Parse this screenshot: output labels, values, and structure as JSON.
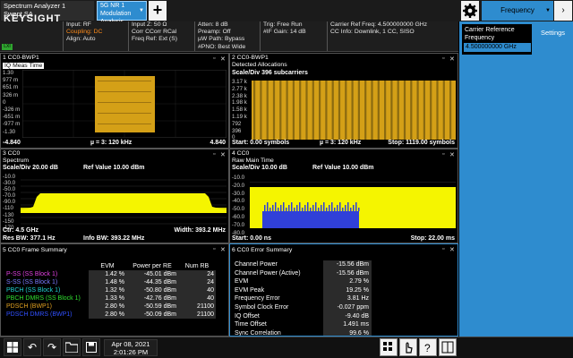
{
  "tabs": {
    "app_line1": "Spectrum Analyzer 1",
    "app_line2": "Swept SA",
    "mode_line1": "5G NR 1",
    "mode_line2": "Modulation Analysis",
    "add_label": "+"
  },
  "status": {
    "logo": "KEYSIGHT",
    "lxi": "LXI",
    "group1": [
      "Input: RF",
      "Coupling: DC",
      "Align: Auto"
    ],
    "group2": [
      "Input Z: 50 Ω",
      "Corr CCorr RCal",
      "Freq Ref: Ext (S)"
    ],
    "group3": [
      "Atten: 8 dB",
      "Preamp: Off",
      "µW Path: Bypass",
      "#PNO: Best Wide"
    ],
    "group4": [
      "Trig: Free Run",
      "#IF Gain: 14 dB"
    ],
    "group5": [
      "Carrier Ref Freq: 4.500000000 GHz",
      "CC Info: Downlink, 1 CC, SISO"
    ]
  },
  "menu": {
    "title": "Frequency",
    "carrier_label": "Carrier Reference Frequency",
    "carrier_value": "4.500000000 GHz",
    "settings": "Settings"
  },
  "win1": {
    "title1": "1 CC0-BWP1",
    "title2": "IQ Meas Time",
    "ylabels": [
      "1.30",
      "977 m",
      "651 m",
      "326 m",
      "0",
      "-326 m",
      "-651 m",
      "-977 m",
      "-1.30"
    ],
    "foot_left": "-4.840",
    "foot_mid": "µ = 3: 120 kHz",
    "foot_right": "4.840"
  },
  "win2": {
    "title1": "2 CC0-BWP1",
    "title2": "Detected Allocations",
    "header": "Scale/Div 396 subcarriers",
    "ylabels": [
      "3.17 k",
      "2.77 k",
      "2.38 k",
      "1.98 k",
      "1.58 k",
      "1.19 k",
      "792",
      "396",
      "0"
    ],
    "foot_left": "Start: 0.00 symbols",
    "foot_mid": "µ = 3: 120 kHz",
    "foot_right": "Stop: 1119.00 symbols"
  },
  "win3": {
    "title1": "3 CC0",
    "title2": "Spectrum",
    "header_left": "Scale/Div 20.00 dB",
    "header_right": "Ref Value 10.00 dBm",
    "ylabels": [
      "-10.0",
      "-30.0",
      "-50.0",
      "-70.0",
      "-90.0",
      "-110",
      "-130",
      "-150",
      "-170"
    ],
    "foot1_left": "Ctr: 4.5 GHz",
    "foot1_right": "Width: 393.2 MHz",
    "foot2_left": "Res BW: 377.1 Hz",
    "foot2_mid": "Info BW: 393.22 MHz"
  },
  "win4": {
    "title1": "4 CC0",
    "title2": "Raw Main Time",
    "header_left": "Scale/Div 10.00 dB",
    "header_right": "Ref Value 10.00 dBm",
    "ylabels": [
      "-10.0",
      "-20.0",
      "-30.0",
      "-40.0",
      "-50.0",
      "-60.0",
      "-70.0",
      "-80.0"
    ],
    "foot_left": "Start: 0.00 ns",
    "foot_right": "Stop: 22.00 ms"
  },
  "win5": {
    "title": "5 CC0 Frame Summary",
    "columns": [
      "",
      "EVM",
      "Power per RE",
      "Num RB"
    ],
    "rows": [
      {
        "name": "P-SS (SS Block 1)",
        "color": "#e040e0",
        "evm": "1.42 %",
        "power": "-45.01 dBm",
        "rb": "24"
      },
      {
        "name": "S-SS (SS Block 1)",
        "color": "#7a7aff",
        "evm": "1.48 %",
        "power": "-44.35 dBm",
        "rb": "24"
      },
      {
        "name": "PBCH (SS Block 1)",
        "color": "#20d0d0",
        "evm": "1.32 %",
        "power": "-50.80 dBm",
        "rb": "40"
      },
      {
        "name": "PBCH DMRS (SS Block 1)",
        "color": "#30e030",
        "evm": "1.33 %",
        "power": "-42.76 dBm",
        "rb": "40"
      },
      {
        "name": "PDSCH (BWP1)",
        "color": "#e0a020",
        "evm": "2.80 %",
        "power": "-50.59 dBm",
        "rb": "21100"
      },
      {
        "name": "PDSCH DMRS (BWP1)",
        "color": "#3050ff",
        "evm": "2.80 %",
        "power": "-50.09 dBm",
        "rb": "21100"
      }
    ]
  },
  "win6": {
    "title": "6 CC0 Error Summary",
    "rows": [
      {
        "label": "Channel Power",
        "value": "-15.56 dBm"
      },
      {
        "label": "Channel Power (Active)",
        "value": "-15.56 dBm"
      },
      {
        "label": "EVM",
        "value": "2.79 %"
      },
      {
        "label": "EVM Peak",
        "value": "19.25 %"
      },
      {
        "label": "Frequency Error",
        "value": "3.81 Hz"
      },
      {
        "label": "Symbol Clock Error",
        "value": "-0.027 ppm"
      },
      {
        "label": "IQ Offset",
        "value": "-9.40 dB"
      },
      {
        "label": "Time Offset",
        "value": "1.491 ms"
      },
      {
        "label": "Sync Correlation",
        "value": "99.6 %"
      }
    ]
  },
  "taskbar": {
    "date": "Apr 08, 2021",
    "time": "2:01:26 PM"
  },
  "colors": {
    "trace_yellow": "#f5f500",
    "constellation": "#d4a017",
    "accent_blue": "#2e8ccf",
    "trace_blue": "#3040d8"
  }
}
